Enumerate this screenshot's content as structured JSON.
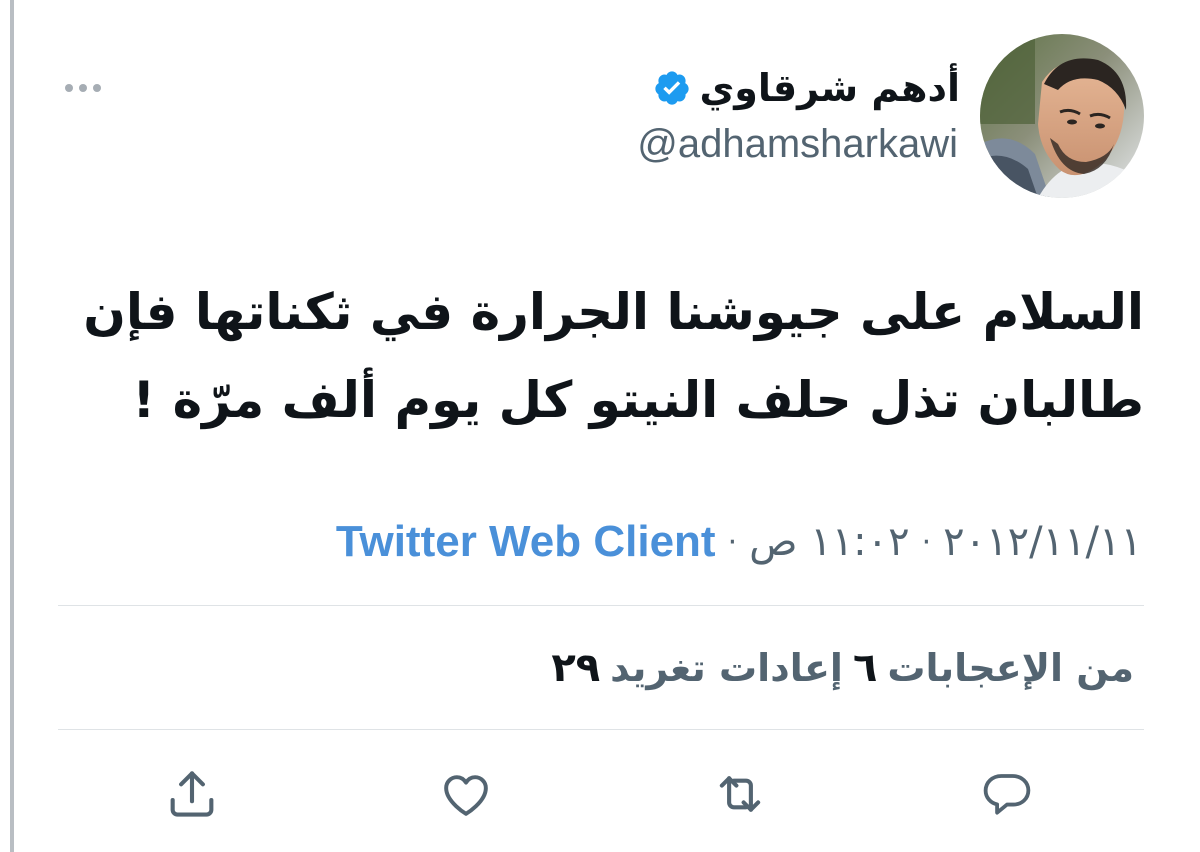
{
  "tweet": {
    "display_name": "أدهم شرقاوي",
    "username": "@adhamsharkawi",
    "verified": true,
    "text_line1": "السلام على جيوشنا الجرارة في ثكناتها فإن",
    "text_line2": "طالبان تذل حلف النيتو كل يوم ألف مرّة !",
    "date": "٢٠١٢/١١/١١",
    "time": "١١:٠٢ ص",
    "separator": "·",
    "source": "Twitter Web Client"
  },
  "stats": {
    "retweets_count": "٢٩",
    "retweets_label": "إعادات تغريد",
    "likes_count": "٦",
    "likes_label": "من الإعجابات"
  },
  "colors": {
    "accent": "#1d9bf0",
    "source_link": "#4a90d9",
    "secondary_text": "#536471",
    "primary_text": "#0f1419",
    "divider": "#dfe3e6",
    "left_rule": "#b9bec3"
  },
  "icons": {
    "more": "more-dots-icon",
    "verified": "verified-badge-icon",
    "reply": "reply-icon",
    "retweet": "retweet-icon",
    "like": "heart-icon",
    "share": "share-icon"
  }
}
